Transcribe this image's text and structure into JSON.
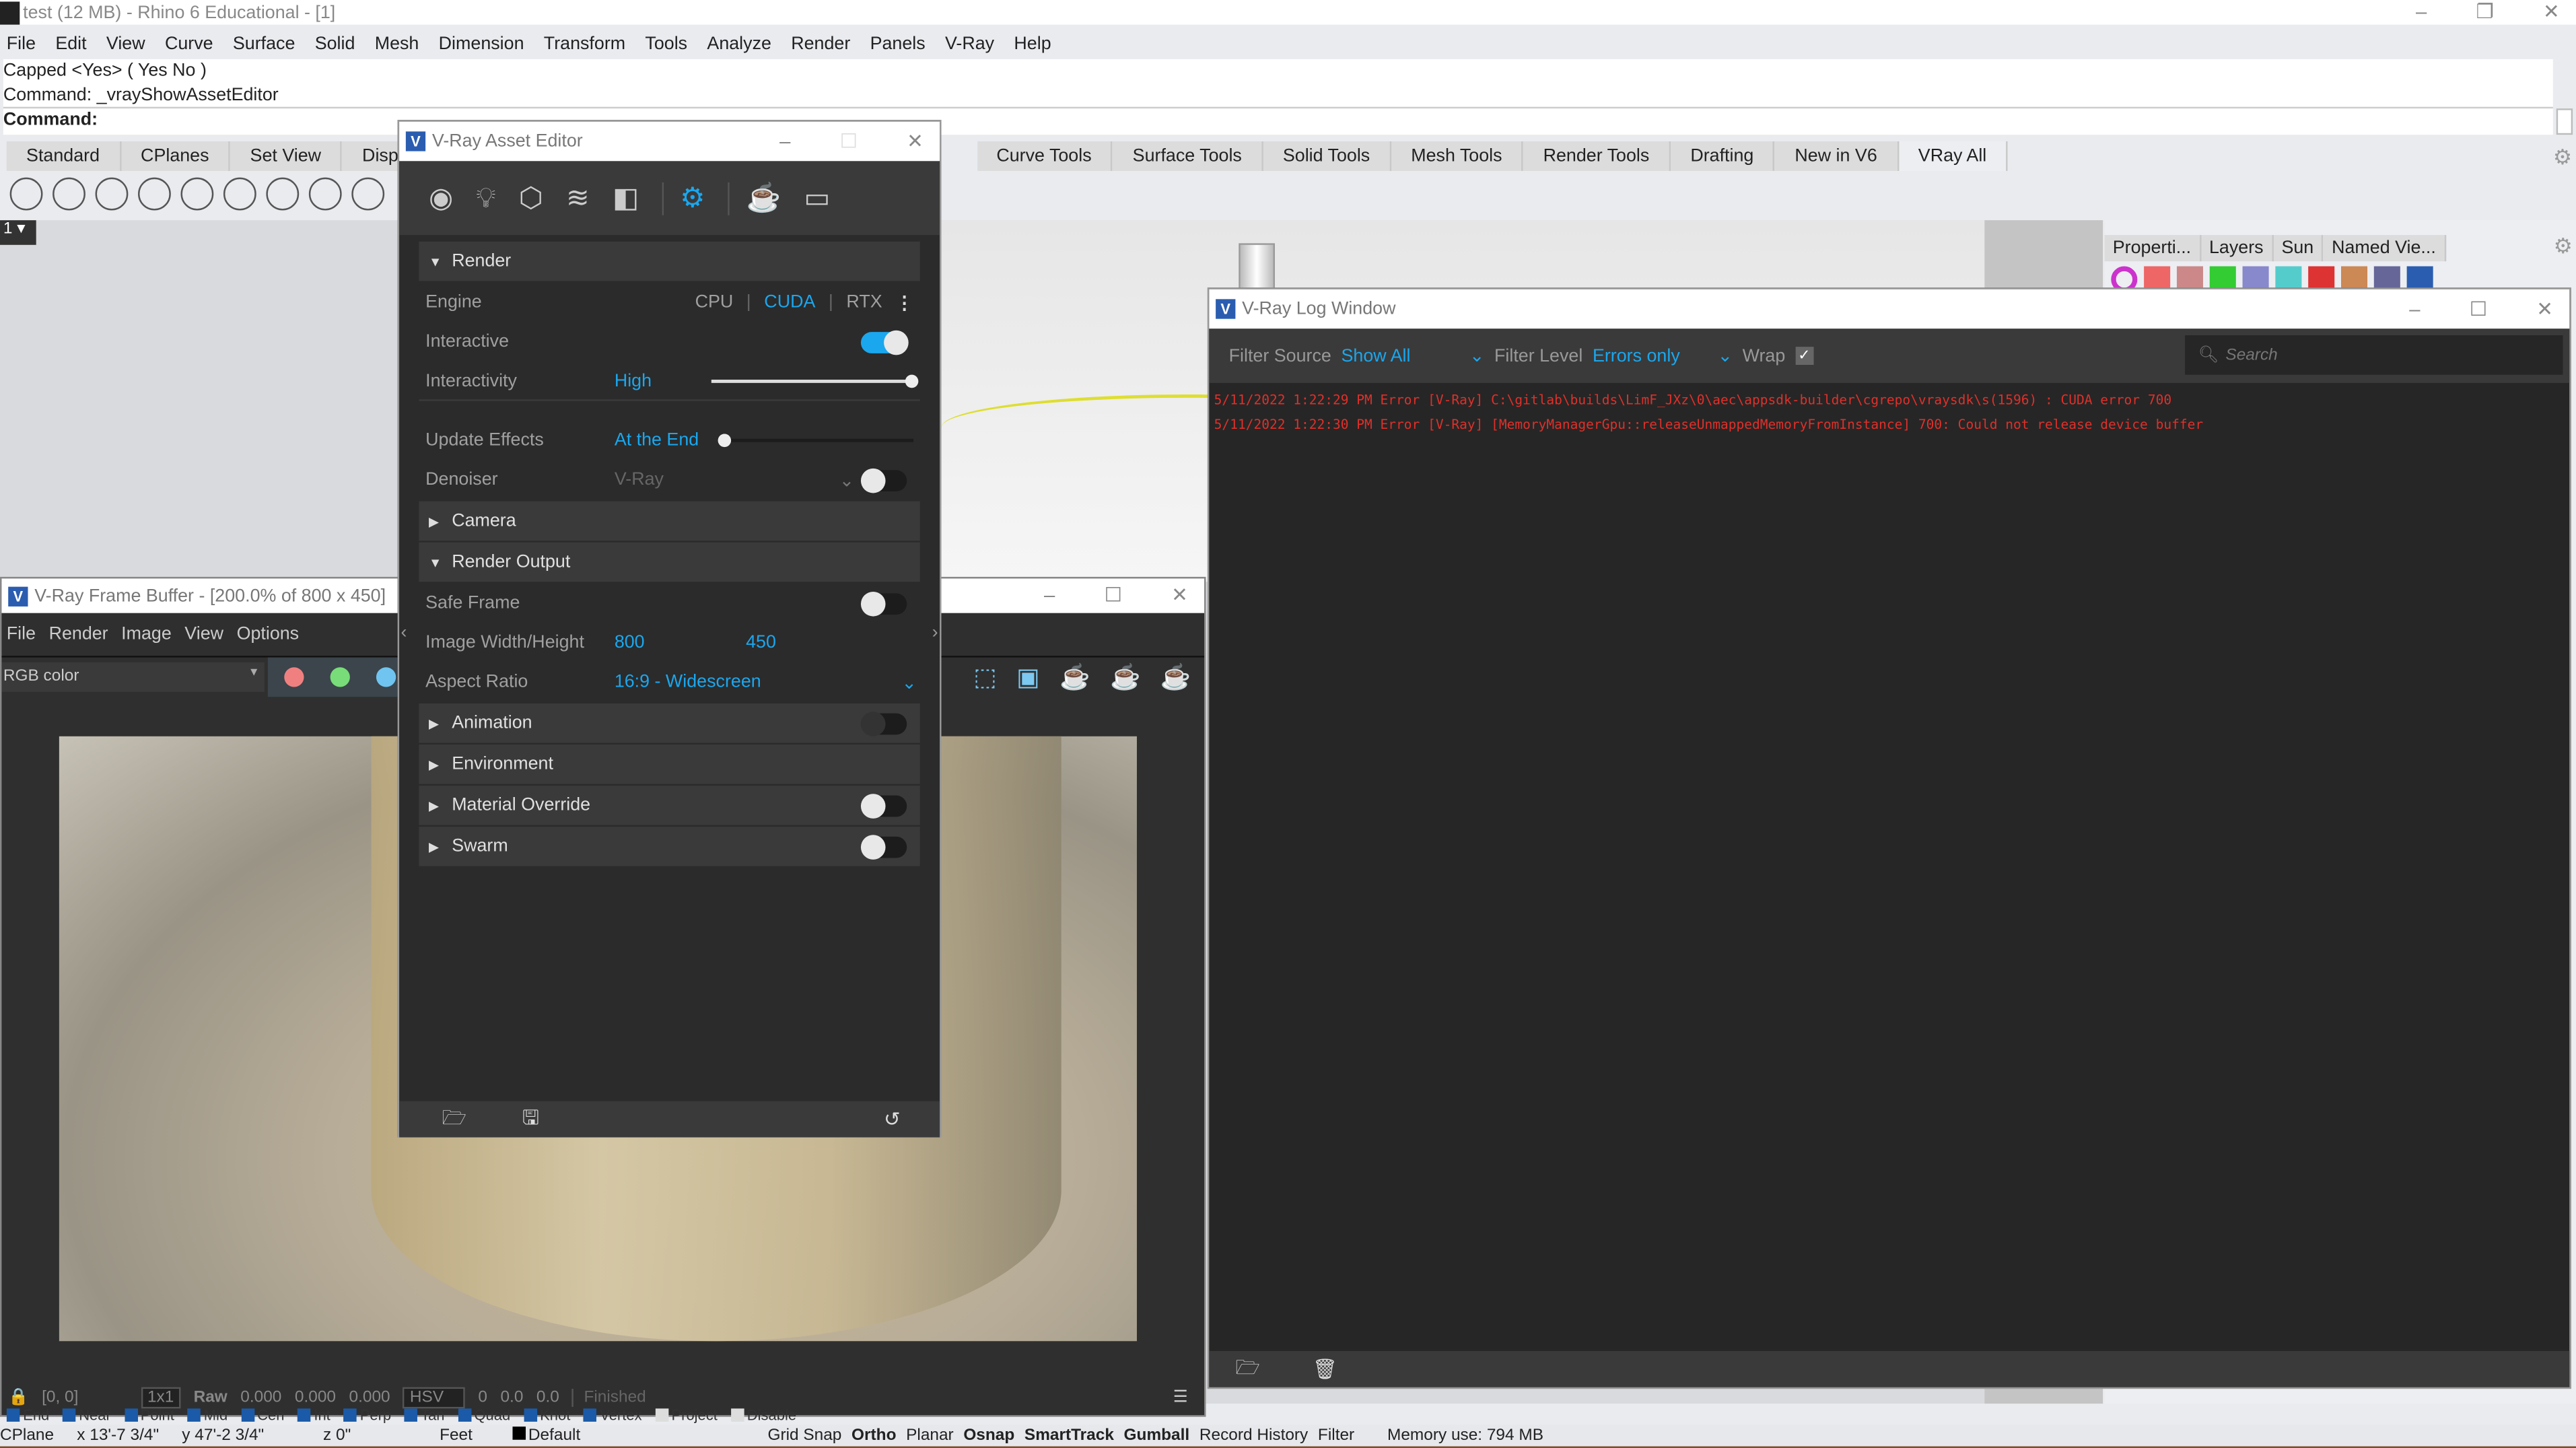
{
  "app": {
    "title": "test (12 MB) - Rhino 6 Educational - [1]"
  },
  "menu": [
    "File",
    "Edit",
    "View",
    "Curve",
    "Surface",
    "Solid",
    "Mesh",
    "Dimension",
    "Transform",
    "Tools",
    "Analyze",
    "Render",
    "Panels",
    "V-Ray",
    "Help"
  ],
  "command": {
    "line1": "Capped <Yes> ( Yes  No )",
    "line2": "Command: _vrayShowAssetEditor",
    "prompt": "Command:"
  },
  "toolbar_tabs": [
    "Standard",
    "CPlanes",
    "Set View",
    "Display",
    "Curve Tools",
    "Surface Tools",
    "Solid Tools",
    "Mesh Tools",
    "Render Tools",
    "Drafting",
    "New in V6",
    "VRay All"
  ],
  "viewport": {
    "label": "1"
  },
  "panel_tabs": [
    "Properti...",
    "Layers",
    "Sun",
    "Named Vie..."
  ],
  "asset_editor": {
    "title": "V-Ray Asset Editor",
    "render_section": "Render",
    "engine": {
      "label": "Engine",
      "options": [
        "CPU",
        "CUDA",
        "RTX"
      ],
      "selected": "CUDA"
    },
    "interactive": {
      "label": "Interactive",
      "on": true
    },
    "interactivity": {
      "label": "Interactivity",
      "value": "High",
      "slider": 1.0
    },
    "update_effects": {
      "label": "Update Effects",
      "value": "At the End",
      "slider": 0.0
    },
    "denoiser": {
      "label": "Denoiser",
      "value": "V-Ray",
      "on": false
    },
    "camera": "Camera",
    "render_output": "Render Output",
    "safe_frame": {
      "label": "Safe Frame",
      "on": false
    },
    "image_size": {
      "label": "Image Width/Height",
      "width": "800",
      "height": "450"
    },
    "aspect": {
      "label": "Aspect Ratio",
      "value": "16:9 - Widescreen"
    },
    "sections": [
      {
        "label": "Animation",
        "on": false
      },
      {
        "label": "Environment"
      },
      {
        "label": "Material Override",
        "on": false
      },
      {
        "label": "Swarm",
        "on": false
      }
    ],
    "accent": "#1aa7ee"
  },
  "frame_buffer": {
    "title": "V-Ray Frame Buffer - [200.0% of 800 x 450]",
    "menu": [
      "File",
      "Render",
      "Image",
      "View",
      "Options"
    ],
    "channel": "RGB color",
    "bottom": {
      "coords": "[0, 0]",
      "zoom": "1x1",
      "raw": "Raw",
      "r": "0.000",
      "g": "0.000",
      "b": "0.000",
      "mode": "HSV",
      "h": "0",
      "s": "0.0",
      "v": "0.0",
      "status": "Finished"
    }
  },
  "log_window": {
    "title": "V-Ray Log Window",
    "filter_source_label": "Filter Source",
    "filter_source": "Show All",
    "filter_level_label": "Filter Level",
    "filter_level": "Errors only",
    "wrap_label": "Wrap",
    "wrap": true,
    "search_placeholder": "Search",
    "lines": [
      "5/11/2022 1:22:29 PM Error [V-Ray] C:\\gitlab\\builds\\LimF_JXz\\0\\aec\\appsdk-builder\\cgrepo\\vraysdk\\s(1596) : CUDA error 700",
      "5/11/2022 1:22:30 PM Error [V-Ray] [MemoryManagerGpu::releaseUnmappedMemoryFromInstance] 700: Could not release device buffer"
    ],
    "error_color": "#e0302a"
  },
  "osnap": [
    "End",
    "Near",
    "Point",
    "Mid",
    "Cen",
    "Int",
    "Perp",
    "Tan",
    "Quad",
    "Knot",
    "Vertex",
    "Project",
    "Disable"
  ],
  "status": {
    "cplane": "CPlane",
    "x": "x 13'-7 3/4\"",
    "y": "y 47'-2 3/4\"",
    "z": "z 0\"",
    "units": "Feet",
    "layer": "Default",
    "toggles": [
      "Grid Snap",
      "Ortho",
      "Planar",
      "Osnap",
      "SmartTrack",
      "Gumball",
      "Record History",
      "Filter"
    ],
    "memory": "Memory use: 794 MB"
  }
}
